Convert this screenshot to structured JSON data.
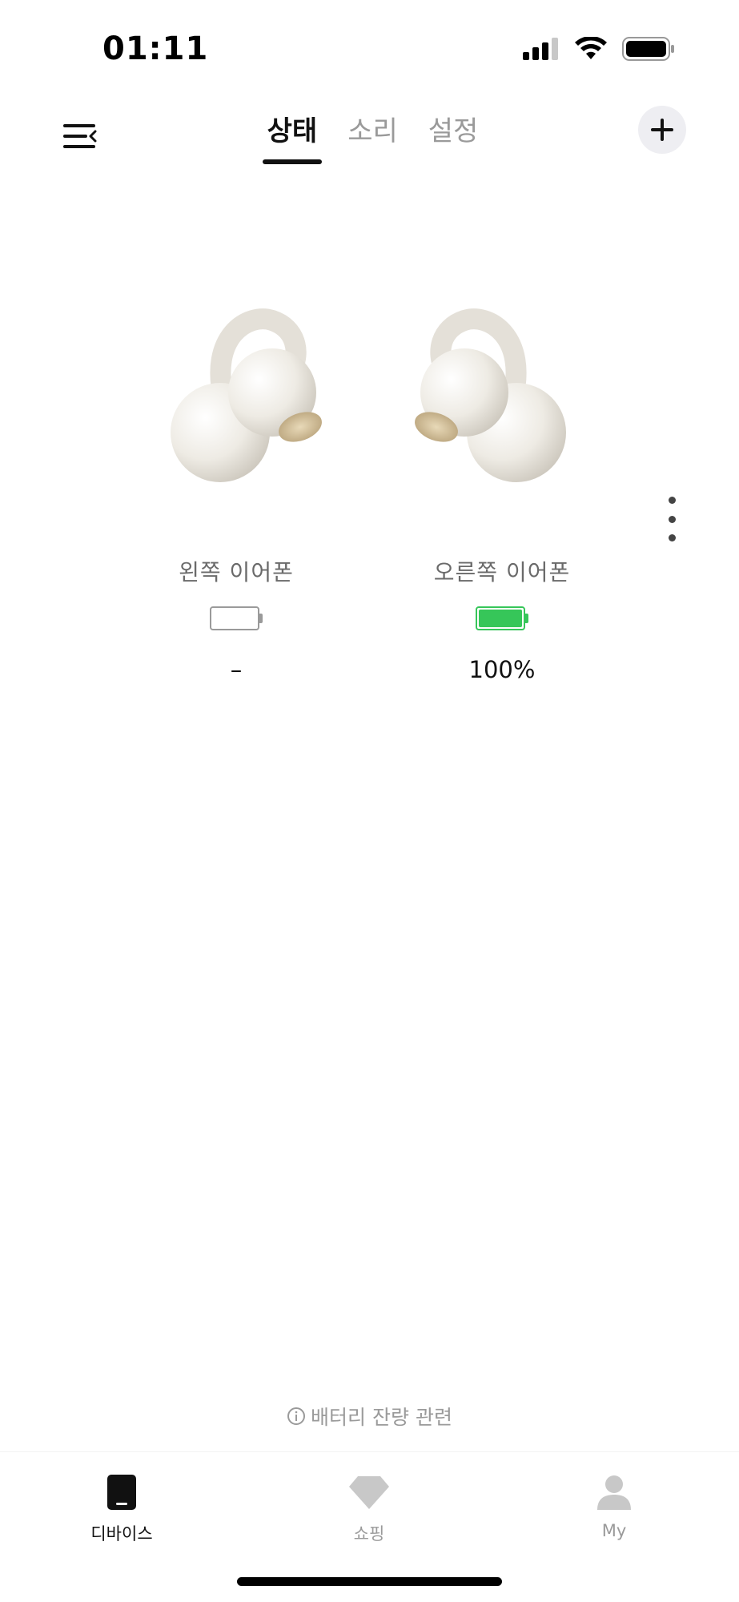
{
  "status_bar": {
    "time": "01:11",
    "icons": [
      "cellular-signal-icon",
      "wifi-icon",
      "battery-icon"
    ]
  },
  "header": {
    "menu_icon": "menu-icon",
    "tabs": [
      {
        "label": "상태",
        "active": true
      },
      {
        "label": "소리",
        "active": false
      },
      {
        "label": "설정",
        "active": false
      }
    ],
    "add_icon": "plus-icon"
  },
  "earphones": {
    "left": {
      "label": "왼쪽 이어폰",
      "value": "–",
      "battery_level": 0
    },
    "right": {
      "label": "오른쪽 이어폰",
      "value": "100%",
      "battery_level": 1.0
    }
  },
  "battery_info": {
    "icon": "info-circle-icon",
    "label": "배터리 잔량 관련"
  },
  "bottom_nav": [
    {
      "label": "디바이스",
      "icon": "device-icon",
      "active": true
    },
    {
      "label": "쇼핑",
      "icon": "diamond-icon",
      "active": false
    },
    {
      "label": "My",
      "icon": "person-icon",
      "active": false
    }
  ],
  "colors": {
    "accent": "#111111",
    "battery_full": "#36c659",
    "inactive": "#9a9a9a",
    "add_button_bg": "#eeeef2"
  }
}
